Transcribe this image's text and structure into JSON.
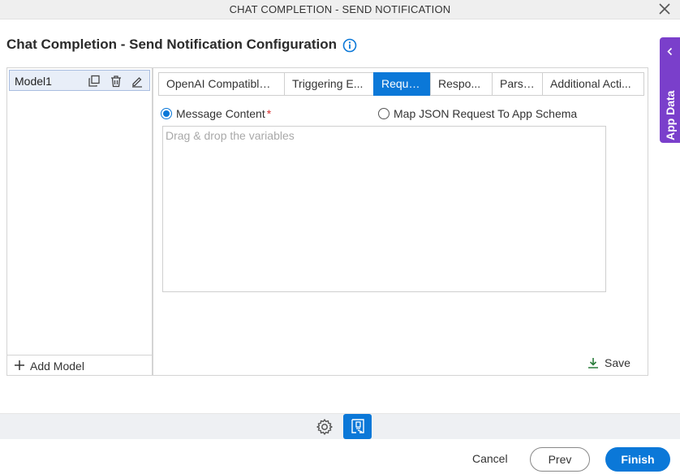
{
  "window": {
    "title": "CHAT COMPLETION - SEND NOTIFICATION",
    "close_icon": "close-icon"
  },
  "page": {
    "title": "Chat Completion - Send Notification Configuration",
    "info_icon": "info-icon"
  },
  "app_data_panel": {
    "label": "App Data",
    "icon": "chevron-left-icon",
    "color": "#7a3fcb"
  },
  "models": {
    "items": [
      {
        "name": "Model1",
        "selected": true
      }
    ],
    "item_icons": [
      "copy-icon",
      "trash-icon",
      "edit-icon"
    ],
    "add_label": "Add Model"
  },
  "tabs": [
    {
      "label": "OpenAI Compatible ...",
      "active": false
    },
    {
      "label": "Triggering E...",
      "active": false
    },
    {
      "label": "Reque...",
      "active": true
    },
    {
      "label": "Respo...",
      "active": false
    },
    {
      "label": "Parsi...",
      "active": false
    },
    {
      "label": "Additional Acti...",
      "active": false
    }
  ],
  "request": {
    "options": [
      {
        "label": "Message Content",
        "required_mark": "*",
        "checked": true
      },
      {
        "label": "Map JSON Request To App Schema",
        "checked": false
      }
    ],
    "drop_placeholder": "Drag & drop the variables",
    "save_label": "Save"
  },
  "toolbar": {
    "icons": [
      "gear-icon",
      "document-config-icon"
    ]
  },
  "footer": {
    "cancel_label": "Cancel",
    "prev_label": "Prev",
    "finish_label": "Finish"
  },
  "colors": {
    "accent": "#0b78d8",
    "purple": "#7a3fcb",
    "required": "#d62d2d",
    "save_icon": "#2a7d3b"
  }
}
